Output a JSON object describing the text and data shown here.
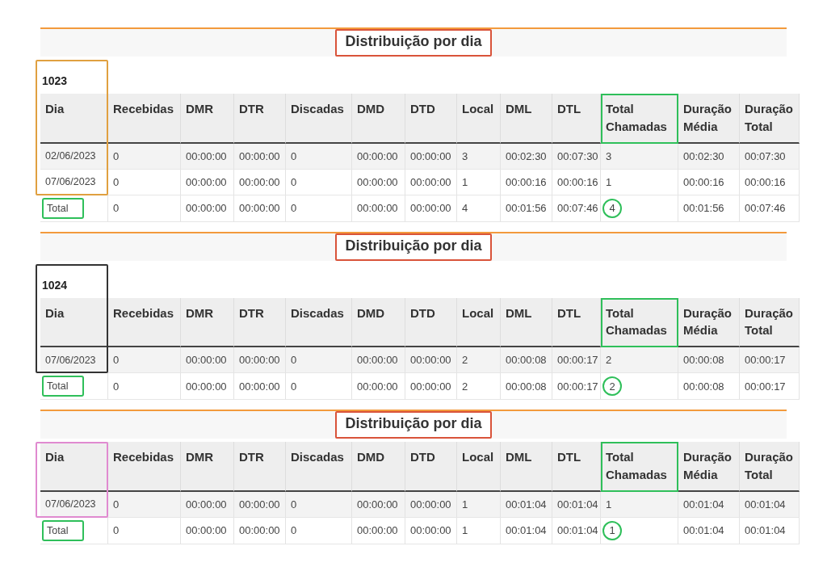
{
  "sections": [
    {
      "title": "Distribuição por dia",
      "title_marked": true,
      "group": "1023",
      "dia_marker": {
        "color": "#e0a040"
      },
      "columns": [
        {
          "label": "Dia",
          "marked": false
        },
        {
          "label": "Recebidas",
          "marked": false
        },
        {
          "label": "DMR",
          "marked": false
        },
        {
          "label": "DTR",
          "marked": false
        },
        {
          "label": "Discadas",
          "marked": false
        },
        {
          "label": "DMD",
          "marked": false
        },
        {
          "label": "DTD",
          "marked": false
        },
        {
          "label": "Local",
          "marked": false
        },
        {
          "label": "DML",
          "marked": false
        },
        {
          "label": "DTL",
          "marked": false
        },
        {
          "label": "Total Chamadas",
          "marked": true
        },
        {
          "label": "Duração Média",
          "marked": false
        },
        {
          "label": "Duração Total",
          "marked": false
        }
      ],
      "rows": [
        {
          "kind": "data",
          "cells": [
            "02/06/2023",
            "0",
            "00:00:00",
            "00:00:00",
            "0",
            "00:00:00",
            "00:00:00",
            "3",
            "00:02:30",
            "00:07:30",
            "3",
            "00:02:30",
            "00:07:30"
          ]
        },
        {
          "kind": "data",
          "cells": [
            "07/06/2023",
            "0",
            "00:00:00",
            "00:00:00",
            "0",
            "00:00:00",
            "00:00:00",
            "1",
            "00:00:16",
            "00:00:16",
            "1",
            "00:00:16",
            "00:00:16"
          ]
        },
        {
          "kind": "total",
          "marked": true,
          "cells": [
            "Total",
            "0",
            "00:00:00",
            "00:00:00",
            "0",
            "00:00:00",
            "00:00:00",
            "4",
            "00:01:56",
            "00:07:46",
            "4",
            "00:01:56",
            "00:07:46"
          ]
        }
      ]
    },
    {
      "title": "Distribuição por dia",
      "title_marked": true,
      "group": "1024",
      "dia_marker": {
        "color": "#333333"
      },
      "columns": [
        {
          "label": "Dia",
          "marked": false
        },
        {
          "label": "Recebidas",
          "marked": false
        },
        {
          "label": "DMR",
          "marked": false
        },
        {
          "label": "DTR",
          "marked": false
        },
        {
          "label": "Discadas",
          "marked": false
        },
        {
          "label": "DMD",
          "marked": false
        },
        {
          "label": "DTD",
          "marked": false
        },
        {
          "label": "Local",
          "marked": false
        },
        {
          "label": "DML",
          "marked": false
        },
        {
          "label": "DTL",
          "marked": false
        },
        {
          "label": "Total Chamadas",
          "marked": true
        },
        {
          "label": "Duração Média",
          "marked": false
        },
        {
          "label": "Duração Total",
          "marked": false
        }
      ],
      "rows": [
        {
          "kind": "data",
          "cells": [
            "07/06/2023",
            "0",
            "00:00:00",
            "00:00:00",
            "0",
            "00:00:00",
            "00:00:00",
            "2",
            "00:00:08",
            "00:00:17",
            "2",
            "00:00:08",
            "00:00:17"
          ]
        },
        {
          "kind": "total",
          "marked": true,
          "cells": [
            "Total",
            "0",
            "00:00:00",
            "00:00:00",
            "0",
            "00:00:00",
            "00:00:00",
            "2",
            "00:00:08",
            "00:00:17",
            "2",
            "00:00:08",
            "00:00:17"
          ]
        }
      ]
    },
    {
      "title": "Distribuição por dia",
      "title_marked": true,
      "dia_marker": {
        "color": "#e08ad0"
      },
      "columns": [
        {
          "label": "Dia",
          "marked": false
        },
        {
          "label": "Recebidas",
          "marked": false
        },
        {
          "label": "DMR",
          "marked": false
        },
        {
          "label": "DTR",
          "marked": false
        },
        {
          "label": "Discadas",
          "marked": false
        },
        {
          "label": "DMD",
          "marked": false
        },
        {
          "label": "DTD",
          "marked": false
        },
        {
          "label": "Local",
          "marked": false
        },
        {
          "label": "DML",
          "marked": false
        },
        {
          "label": "DTL",
          "marked": false
        },
        {
          "label": "Total Chamadas",
          "marked": true
        },
        {
          "label": "Duração Média",
          "marked": false
        },
        {
          "label": "Duração Total",
          "marked": false
        }
      ],
      "rows": [
        {
          "kind": "data",
          "cells": [
            "07/06/2023",
            "0",
            "00:00:00",
            "00:00:00",
            "0",
            "00:00:00",
            "00:00:00",
            "1",
            "00:01:04",
            "00:01:04",
            "1",
            "00:01:04",
            "00:01:04"
          ]
        },
        {
          "kind": "total",
          "marked": true,
          "cells": [
            "Total",
            "0",
            "00:00:00",
            "00:00:00",
            "0",
            "00:00:00",
            "00:00:00",
            "1",
            "00:01:04",
            "00:01:04",
            "1",
            "00:01:04",
            "00:01:04"
          ]
        }
      ]
    }
  ]
}
